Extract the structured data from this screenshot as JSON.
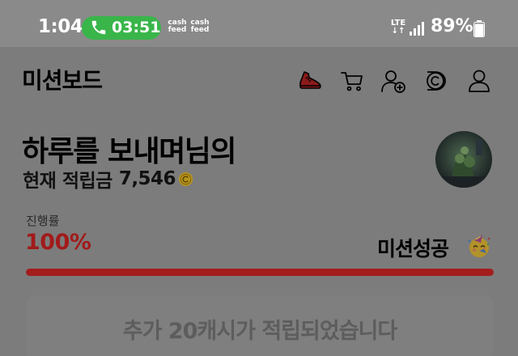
{
  "status_bar": {
    "time": "1:04",
    "call_timer": "03:51",
    "cashfeed_labels": [
      "cash feed",
      "cash feed"
    ],
    "network": "LTE",
    "battery_percent": "89%",
    "battery_level": 0.89
  },
  "header": {
    "title": "미션보드",
    "icons": [
      "shoe-icon",
      "cart-icon",
      "person-plus-icon",
      "coin-card-icon",
      "profile-icon"
    ]
  },
  "user": {
    "name": "하루를 보내며님의",
    "balance_label": "현재 적립금",
    "balance_value": "7,546"
  },
  "progress": {
    "label": "진행률",
    "value": "100%",
    "fraction": 1.0,
    "status_text": "미션성공"
  },
  "notice": {
    "text": "추가 20캐시가 적립되었습니다"
  },
  "colors": {
    "accent_red": "#a41d1d",
    "call_green": "#39b54a",
    "coin_gold": "#c8a21e"
  }
}
